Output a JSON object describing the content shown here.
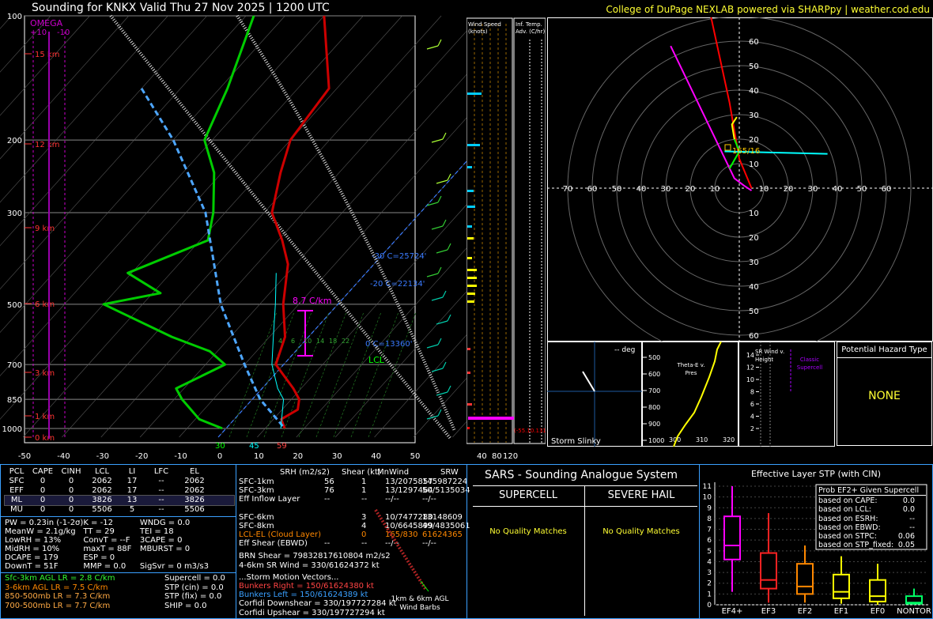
{
  "header": {
    "title": "Sounding for KNKX Valid  Thu 27 Nov 2025 | 1200 UTC",
    "credit": "College of DuPage NEXLAB powered via SHARPpy | weather.cod.edu"
  },
  "skewt": {
    "pressure_ticks": [
      "100",
      "200",
      "300",
      "500",
      "700",
      "850",
      "1000"
    ],
    "temp_ticks": [
      "-50",
      "-40",
      "-30",
      "-20",
      "-10",
      "0",
      "10",
      "20",
      "30",
      "40",
      "50"
    ],
    "height_labels": [
      "15 km",
      "12 km",
      "9 km",
      "6 km",
      "3 km",
      "1 km",
      "0 km"
    ],
    "omega_label": "OMEGA",
    "omega_scale": [
      "+10",
      "-10"
    ],
    "lapse_rate_label": "8.7 C/km",
    "lcl_label": "LCL",
    "isotherm_labels": [
      "-30 C=25724'",
      "-20 C=22134'",
      "0 C=13360'"
    ],
    "sfc_readouts": {
      "dewpoint": "30",
      "wetbulb": "45",
      "temp": "59"
    },
    "mixing_ratios": [
      "4",
      "6",
      "10",
      "14",
      "18",
      "22"
    ],
    "wind_axis": [
      "40",
      "80",
      "120"
    ],
    "col_wind_title": "Wind Speed (knots)",
    "col_adv_title": "Inf. Temp. Adv. (C/hr)",
    "adv_value": "(-55.10.1319)"
  },
  "chart_data": [
    {
      "type": "line",
      "title": "Sounding for KNKX Valid  Thu 27 Nov 2025 | 1200 UTC",
      "xlabel": "",
      "ylabel": "",
      "x_ticks": [
        -50,
        -40,
        -30,
        -20,
        -10,
        0,
        10,
        20,
        30,
        40,
        50
      ],
      "y_ticks_hpa": [
        100,
        200,
        300,
        500,
        700,
        850,
        1000
      ],
      "y_scale": "log",
      "series": [
        {
          "name": "temperature",
          "color": "#cc0000",
          "points": [
            [
              -70,
              100
            ],
            [
              -52,
              150
            ],
            [
              -50,
              200
            ],
            [
              -45,
              240
            ],
            [
              -38,
              300
            ],
            [
              -29,
              350
            ],
            [
              -22,
              400
            ],
            [
              -14,
              500
            ],
            [
              -6,
              600
            ],
            [
              -2,
              700
            ],
            [
              8,
              800
            ],
            [
              12,
              850
            ],
            [
              14,
              900
            ],
            [
              12,
              950
            ],
            [
              15,
              1000
            ]
          ]
        },
        {
          "name": "dewpoint",
          "color": "#00cc00",
          "points": [
            [
              -88,
              100
            ],
            [
              -78,
              150
            ],
            [
              -72,
              200
            ],
            [
              -62,
              240
            ],
            [
              -53,
              300
            ],
            [
              -48,
              350
            ],
            [
              -61,
              420
            ],
            [
              -48,
              470
            ],
            [
              -60,
              500
            ],
            [
              -35,
              600
            ],
            [
              -22,
              650
            ],
            [
              -15,
              700
            ],
            [
              -22,
              800
            ],
            [
              -18,
              850
            ],
            [
              -9,
              950
            ],
            [
              -1,
              1000
            ]
          ]
        },
        {
          "name": "parcel",
          "color": "#4da6ff",
          "points": [
            [
              -100,
              150
            ],
            [
              -80,
              200
            ],
            [
              -55,
              300
            ],
            [
              -30,
              500
            ],
            [
              -10,
              700
            ],
            [
              2,
              850
            ],
            [
              15,
              1000
            ]
          ]
        },
        {
          "name": "virtual",
          "color": "#00ffff",
          "points": [
            [
              -23,
              420
            ],
            [
              -16,
              500
            ],
            [
              -9,
              600
            ],
            [
              -3,
              700
            ],
            [
              4,
              800
            ],
            [
              8,
              850
            ],
            [
              14,
              1000
            ]
          ]
        }
      ]
    },
    {
      "type": "line",
      "title": "",
      "rings_kt": [
        10,
        20,
        30,
        40,
        50,
        60,
        70
      ],
      "series": [
        {
          "name": "hodograph-0-3km",
          "color": "#ff00ff",
          "points": [
            [
              5,
              -1
            ],
            [
              2,
              1
            ],
            [
              -2,
              4
            ],
            [
              -28,
              58
            ]
          ]
        },
        {
          "name": "hodograph-3-6km",
          "color": "#ff0000",
          "points": [
            [
              5,
              0
            ],
            [
              0,
              12
            ],
            [
              -4,
              35
            ],
            [
              -12,
              72
            ]
          ]
        },
        {
          "name": "hodograph-6-9km",
          "color": "#00ff00",
          "points": [
            [
              -4,
              8
            ],
            [
              0,
              15
            ],
            [
              -2,
              20
            ]
          ]
        },
        {
          "name": "hodograph-9-12km",
          "color": "#ffff00",
          "points": [
            [
              -2,
              20
            ],
            [
              -3,
              26
            ],
            [
              -1,
              29
            ]
          ]
        },
        {
          "name": "bunkers-left-vector",
          "color": "#00ffff",
          "points": [
            [
              -6,
              15
            ],
            [
              36,
              14
            ]
          ]
        }
      ],
      "labels": [
        "165/16"
      ]
    },
    {
      "type": "bar",
      "title": "Effective Layer STP (with CIN)",
      "categories": [
        "EF4+",
        "EF3",
        "EF2",
        "EF1",
        "EF0",
        "NONTOR"
      ],
      "box": [
        {
          "q1": 4.2,
          "median": 5.5,
          "q3": 8.2,
          "low": 1.2,
          "high": 11.0
        },
        {
          "q1": 1.5,
          "median": 2.3,
          "q3": 4.8,
          "low": 0.2,
          "high": 8.5
        },
        {
          "q1": 1.0,
          "median": 1.7,
          "q3": 3.8,
          "low": 0.2,
          "high": 5.5
        },
        {
          "q1": 0.6,
          "median": 1.2,
          "q3": 2.8,
          "low": 0.1,
          "high": 4.5
        },
        {
          "q1": 0.3,
          "median": 0.8,
          "q3": 2.3,
          "low": 0.0,
          "high": 3.8
        },
        {
          "q1": 0.1,
          "median": 0.2,
          "q3": 0.8,
          "low": 0.0,
          "high": 1.5
        }
      ],
      "ylim": [
        0,
        11
      ]
    }
  ],
  "hodograph": {
    "ring_labels": [
      "10",
      "20",
      "30",
      "40",
      "50",
      "60",
      "70"
    ],
    "bunkers_label": "165/16"
  },
  "slinky": {
    "deg": "-- deg",
    "label": "Storm Slinky"
  },
  "thetae": {
    "title": "Theta-E v. Pres",
    "pres_ticks": [
      "500",
      "600",
      "700",
      "800",
      "900",
      "1000"
    ],
    "theta_ticks": [
      "300",
      "310",
      "320"
    ]
  },
  "srwind": {
    "title": "SR Wind v. Height",
    "hght_ticks": [
      "14",
      "12",
      "10",
      "8",
      "6",
      "4",
      "2"
    ],
    "label": "Classic Supercell"
  },
  "hazard": {
    "title": "Potential Hazard Type",
    "value": "NONE"
  },
  "parcels": {
    "headers": [
      "PCL",
      "CAPE",
      "CINH",
      "LCL",
      "LI",
      "LFC",
      "EL"
    ],
    "rows": [
      [
        "SFC",
        "0",
        "0",
        "2062",
        "17",
        "--",
        "2062"
      ],
      [
        "EFF",
        "0",
        "0",
        "2062",
        "17",
        "--",
        "2062"
      ],
      [
        "ML",
        "0",
        "0",
        "3826",
        "13",
        "--",
        "3826"
      ],
      [
        "MU",
        "0",
        "0",
        "5506",
        "5",
        "--",
        "5506"
      ]
    ]
  },
  "indices": [
    [
      "PW = 0.23in (-1-2σ)",
      "K = -12",
      "WNDG = 0.0"
    ],
    [
      "MeanW = 2.1g/kg",
      "TT = 29",
      "TEI = 18"
    ],
    [
      "LowRH = 13%",
      "ConvT = --F",
      "3CAPE = 0"
    ],
    [
      "MidRH = 10%",
      "maxT = 88F",
      "MBURST = 0"
    ],
    [
      "DCAPE = 179",
      "ESP = 0",
      ""
    ],
    [
      "DownT = 51F",
      "MMP = 0.0",
      "SigSvr = 0 m3/s3"
    ]
  ],
  "lapse_rates": [
    "Sfc-3km AGL LR = 2.8 C/km",
    "3-6km AGL LR = 7.5 C/km",
    "850-500mb LR = 7.3 C/km",
    "700-500mb LR = 7.7 C/km"
  ],
  "composites": [
    "Supercell = 0.0",
    "STP (cin) = 0.0",
    "STP (fix) = 0.0",
    "SHIP = 0.0"
  ],
  "kinematics": {
    "headers": [
      "SRH (m2/s2)",
      "Shear (kt)",
      "MnWind",
      "SRW"
    ],
    "rows": [
      [
        "SFC-1km",
        "56",
        "1",
        "13/2075857",
        "145987224"
      ],
      [
        "SFC-3km",
        "76",
        "1",
        "13/1297464",
        "50/5135034"
      ],
      [
        "Eff Inflow Layer",
        "--",
        "--",
        "--/--",
        "--/--"
      ],
      [
        "SFC-6km",
        "",
        "3",
        "10/7477280",
        "13148609"
      ],
      [
        "SFC-8km",
        "",
        "4",
        "10/6645899",
        "49/4835061"
      ],
      [
        "LCL-EL (Cloud Layer)",
        "",
        "0",
        "165/830",
        "61624365"
      ],
      [
        "Eff Shear (EBWD)",
        "--",
        "--",
        "--/--",
        "--/--"
      ]
    ],
    "brn": "BRN Shear = 79832817610804 m2/s2",
    "srwind": "4-6km SR Wind =  330/61624372 kt",
    "storm_motion_title": "...Storm Motion Vectors...",
    "bunkers_right": "Bunkers Right =    150/61624380 kt",
    "bunkers_left": "Bunkers Left =    150/61624389 kt",
    "corfidi_down": "Corfidi Downshear = 330/197727284 kt",
    "corfidi_up": "Corfidi Upshear = 330/197727294 kt",
    "barbs_label": "1km & 6km AGL Wind Barbs"
  },
  "sars": {
    "title": "SARS - Sounding Analogue System",
    "col1": "SUPERCELL",
    "col2": "SEVERE HAIL",
    "msg1": "No Quality Matches",
    "msg2": "No Quality Matches"
  },
  "stp": {
    "title": "Effective Layer STP (with CIN)",
    "y_ticks": [
      "0",
      "1",
      "2",
      "3",
      "4",
      "5",
      "6",
      "7",
      "8",
      "9",
      "10",
      "11"
    ],
    "legend_title": "Prob EF2+ Given Supercell",
    "legend": [
      [
        "based on CAPE:",
        "0.0"
      ],
      [
        "based on LCL:",
        "0.0"
      ],
      [
        "based on ESRH:",
        "--"
      ],
      [
        "based on EBWD:",
        "--"
      ],
      [
        "based on STPC:",
        "0.06"
      ],
      [
        "based on STP_fixed:",
        "0.05"
      ]
    ]
  }
}
